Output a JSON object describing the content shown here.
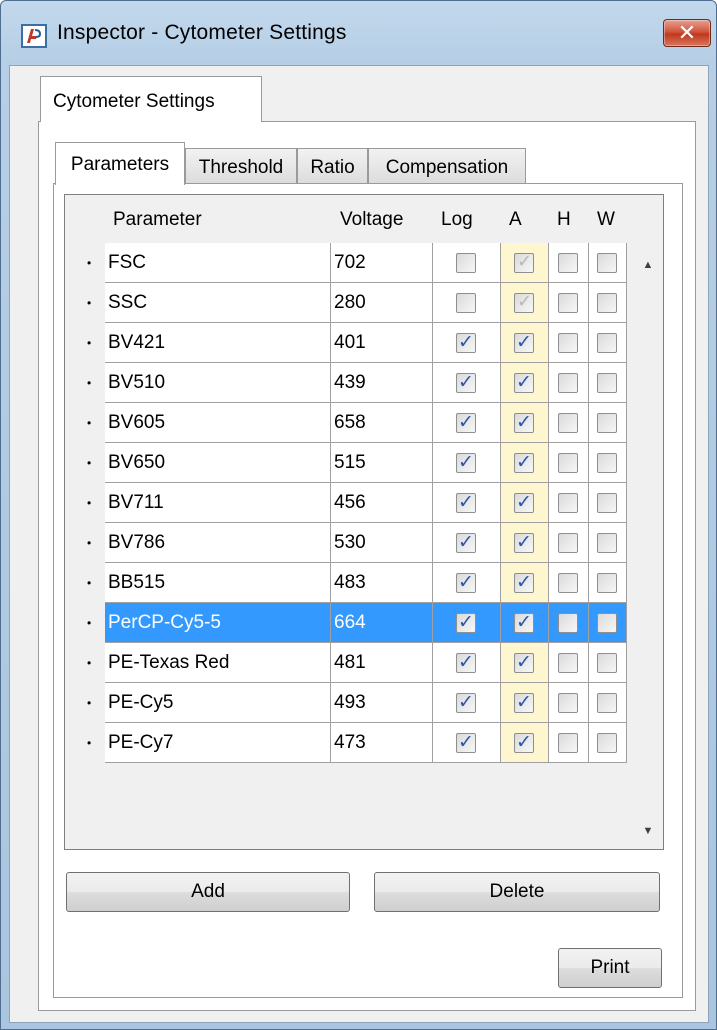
{
  "window": {
    "title": "Inspector - Cytometer Settings",
    "close_glyph": "✕"
  },
  "outer_tab": {
    "label": "Cytometer Settings"
  },
  "inner_tabs": [
    {
      "label": "Parameters",
      "active": true
    },
    {
      "label": "Threshold",
      "active": false
    },
    {
      "label": "Ratio",
      "active": false
    },
    {
      "label": "Compensation",
      "active": false
    }
  ],
  "table": {
    "headers": {
      "parameter": "Parameter",
      "voltage": "Voltage",
      "log": "Log",
      "a": "A",
      "h": "H",
      "w": "W"
    },
    "rows": [
      {
        "parameter": "FSC",
        "voltage": "702",
        "log": false,
        "a": true,
        "a_disabled": true,
        "h": false,
        "w": false
      },
      {
        "parameter": "SSC",
        "voltage": "280",
        "log": false,
        "a": true,
        "a_disabled": true,
        "h": false,
        "w": false
      },
      {
        "parameter": "BV421",
        "voltage": "401",
        "log": true,
        "a": true,
        "a_disabled": false,
        "h": false,
        "w": false
      },
      {
        "parameter": "BV510",
        "voltage": "439",
        "log": true,
        "a": true,
        "a_disabled": false,
        "h": false,
        "w": false
      },
      {
        "parameter": "BV605",
        "voltage": "658",
        "log": true,
        "a": true,
        "a_disabled": false,
        "h": false,
        "w": false
      },
      {
        "parameter": "BV650",
        "voltage": "515",
        "log": true,
        "a": true,
        "a_disabled": false,
        "h": false,
        "w": false
      },
      {
        "parameter": "BV711",
        "voltage": "456",
        "log": true,
        "a": true,
        "a_disabled": false,
        "h": false,
        "w": false
      },
      {
        "parameter": "BV786",
        "voltage": "530",
        "log": true,
        "a": true,
        "a_disabled": false,
        "h": false,
        "w": false
      },
      {
        "parameter": "BB515",
        "voltage": "483",
        "log": true,
        "a": true,
        "a_disabled": false,
        "h": false,
        "w": false
      },
      {
        "parameter": "PerCP-Cy5-5",
        "voltage": "664",
        "log": true,
        "a": true,
        "a_disabled": false,
        "h": false,
        "w": false,
        "selected": true
      },
      {
        "parameter": "PE-Texas Red",
        "voltage": "481",
        "log": true,
        "a": true,
        "a_disabled": false,
        "h": false,
        "w": false
      },
      {
        "parameter": "PE-Cy5",
        "voltage": "493",
        "log": true,
        "a": true,
        "a_disabled": false,
        "h": false,
        "w": false
      },
      {
        "parameter": "PE-Cy7",
        "voltage": "473",
        "log": true,
        "a": true,
        "a_disabled": false,
        "h": false,
        "w": false
      }
    ]
  },
  "buttons": {
    "add": "Add",
    "delete": "Delete",
    "print": "Print"
  },
  "colors": {
    "selection": "#3399ff",
    "a_column": "#fdf6cf",
    "checkmark": "#2d55a8"
  },
  "icons": {
    "app": "app-icon",
    "close": "close-icon",
    "scroll_up": "scroll-up-icon",
    "scroll_down": "scroll-down-icon"
  }
}
